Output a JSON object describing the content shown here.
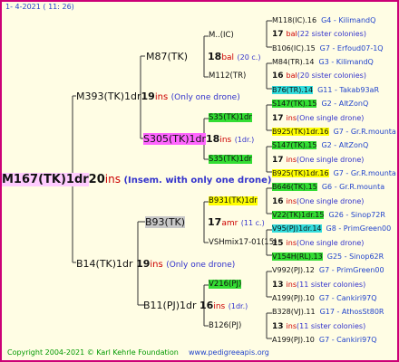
{
  "header": {
    "date": "1-   4-2021  ( 11:  26)"
  },
  "footer": {
    "copyright": "Copyright 2004-2021 © Karl Kehrle Foundation",
    "site": "www.pedigreeapis.org"
  },
  "root": {
    "name": "M167(TK)1dr",
    "num": "20",
    "ins": "ins",
    "note": "(Insem. with only one drone)"
  },
  "gen1": {
    "father": {
      "name": "M393(TK)1dr",
      "num": "19",
      "ins": "ins",
      "note": "(Only one drone)"
    },
    "mother": {
      "name": "B14(TK)1dr",
      "num": "19",
      "ins": "ins",
      "note": "(Only one drone)"
    }
  },
  "gen2": {
    "ff": {
      "name": "M87(TK)",
      "num": "18",
      "ins": "bal",
      "note": "(20 c.)"
    },
    "fm": {
      "name": "S305(TK)1dr",
      "num": "18",
      "ins": "ins",
      "note": "(1dr.)"
    },
    "mf": {
      "name": "B93(TK)",
      "num": "17",
      "ins": "amr",
      "note": "(11 c.)"
    },
    "mm": {
      "name": "B11(PJ)1dr",
      "num": "16",
      "ins": "ins",
      "note": "(1dr.)"
    }
  },
  "gen3": [
    {
      "name": "M..(IC)"
    },
    {
      "name": "M112(TR)"
    },
    {
      "name": "S35(TK)1dr"
    },
    {
      "name": "S35(TK)1dr"
    },
    {
      "name": "B931(TK)1dr"
    },
    {
      "name": "VSHmix17-01(15)"
    },
    {
      "name": "V216(PJ)"
    },
    {
      "name": "B126(PJ)"
    }
  ],
  "gen4": [
    {
      "name": "M118(IC).16",
      "extra": "G4 - KilimandQ"
    },
    {
      "num": "17",
      "ins": "bal",
      "note": "(22 sister colonies)"
    },
    {
      "name": "B106(IC).15",
      "extra": "G7 - Erfoud07-1Q"
    },
    {
      "name": "M84(TR).14",
      "extra": "G3 - KilimandQ"
    },
    {
      "num": "16",
      "ins": "bal",
      "note": "(20 sister colonies)"
    },
    {
      "name": "B76(TR).14",
      "extra": "G11 - Takab93aR"
    },
    {
      "name": "S147(TK).15",
      "extra": "G2 - AltZonQ"
    },
    {
      "num": "17",
      "ins": "ins",
      "note": "(One single drone)"
    },
    {
      "name": "B925(TK)1dr.16",
      "extra": "G7 - Gr.R.mounta"
    },
    {
      "name": "S147(TK).15",
      "extra": "G2 - AltZonQ"
    },
    {
      "num": "17",
      "ins": "ins",
      "note": "(One single drone)"
    },
    {
      "name": "B925(TK)1dr.16",
      "extra": "G7 - Gr.R.mounta"
    },
    {
      "name": "B646(TK).15",
      "extra": "G6 - Gr.R.mounta"
    },
    {
      "num": "16",
      "ins": "ins",
      "note": "(One single drone)"
    },
    {
      "name": "V22(TK)1dr.15",
      "extra": "G26 - Sinop72R"
    },
    {
      "name": "V95(PJ)1dr.14",
      "extra": "G8 - PrimGreen00"
    },
    {
      "num": "15",
      "ins": "ins",
      "note": "(One single drone)"
    },
    {
      "name": "V154H(RL).13",
      "extra": "G25 - Sinop62R"
    },
    {
      "name": "V992(PJ).12",
      "extra": "G7 - PrimGreen00"
    },
    {
      "num": "13",
      "ins": "ins",
      "note": "(11 sister colonies)"
    },
    {
      "name": "A199(PJ).10",
      "extra": "G7 - Cankiri97Q"
    },
    {
      "name": "B328(VJ).11",
      "extra": "G17 - AthosSt80R"
    },
    {
      "num": "13",
      "ins": "ins",
      "note": "(11 sister colonies)"
    },
    {
      "name": "A199(PJ).10",
      "extra": "G7 - Cankiri97Q"
    }
  ]
}
